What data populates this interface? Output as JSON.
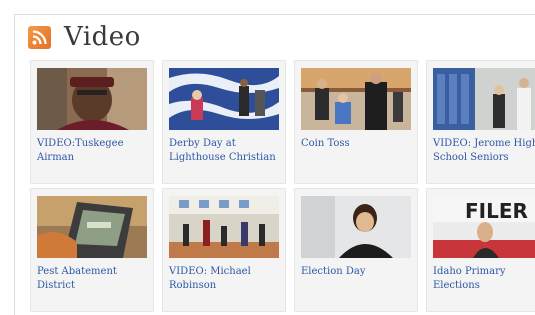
{
  "section": {
    "title": "Video",
    "icon": "rss-feed-icon",
    "accent_color": "#e8782f",
    "link_color": "#2d58a5"
  },
  "videos": [
    {
      "caption": "VIDEO:Tuskegee Airman"
    },
    {
      "caption": "Derby Day at Lighthouse Christian"
    },
    {
      "caption": "Coin Toss"
    },
    {
      "caption": "VIDEO: Jerome High School Seniors"
    },
    {
      "caption": "Pest Abatement District"
    },
    {
      "caption": "VIDEO: Michael Robinson"
    },
    {
      "caption": "Election Day"
    },
    {
      "caption": "Idaho Primary Elections"
    }
  ],
  "thumb_text": {
    "filer": "FILER"
  }
}
